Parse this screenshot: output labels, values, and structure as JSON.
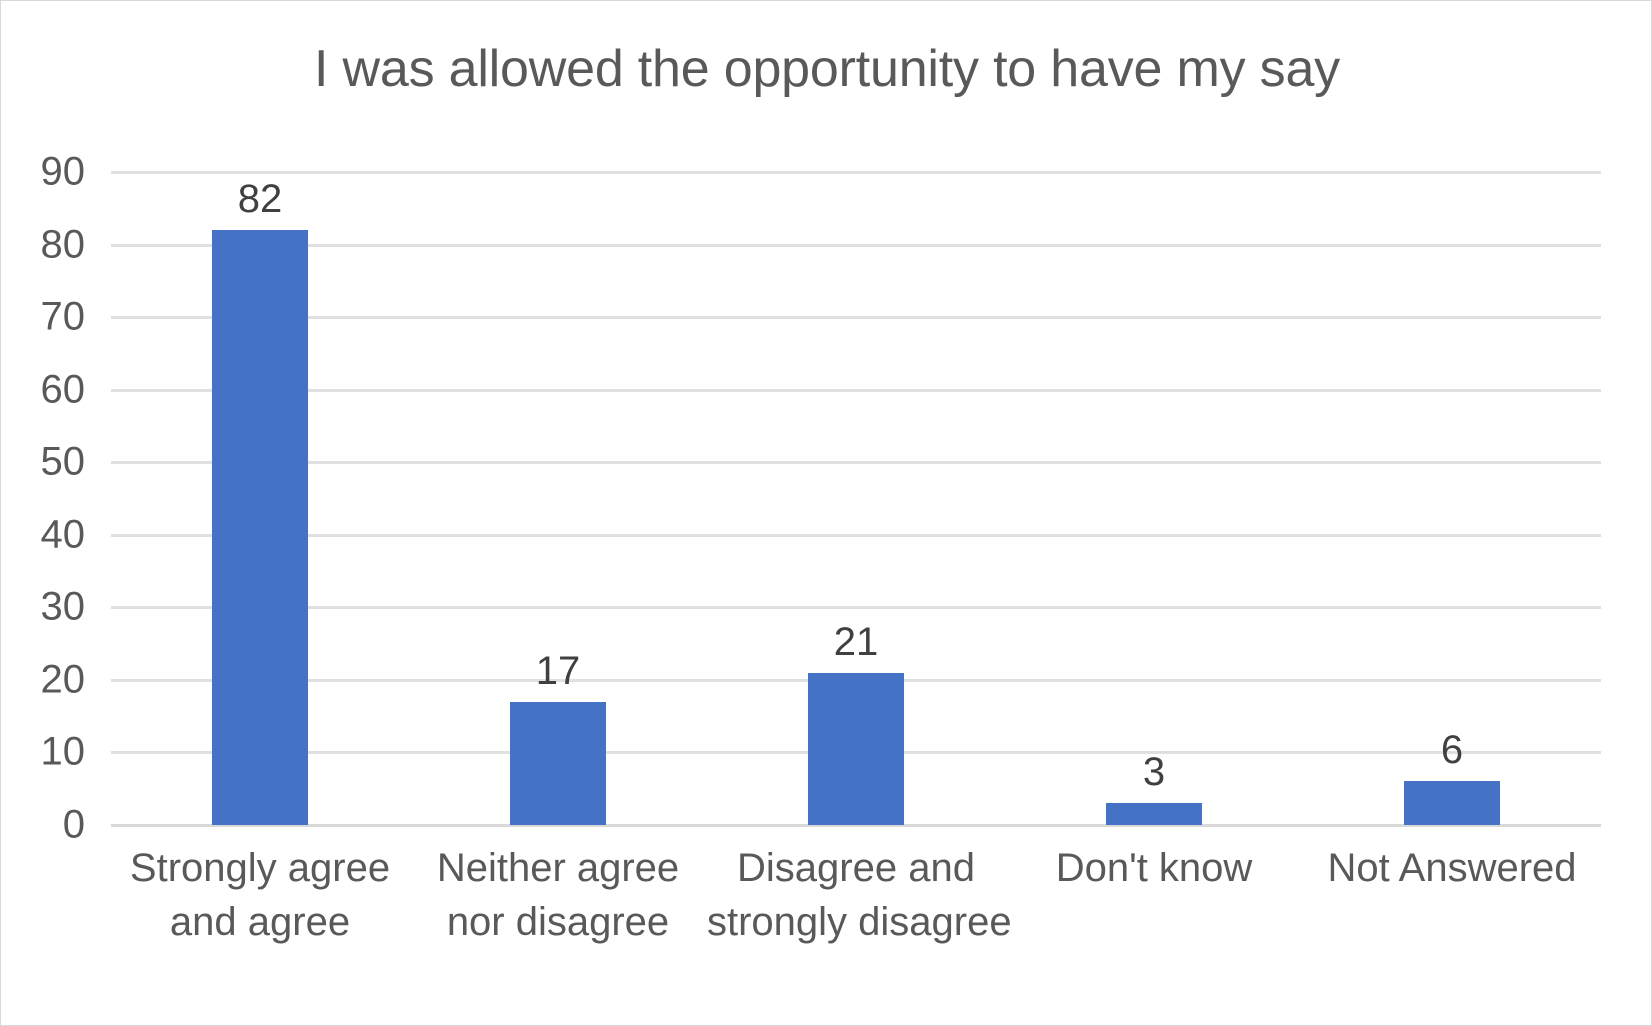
{
  "chart_data": {
    "type": "bar",
    "title": "I was allowed the opportunity to have my say",
    "categories": [
      "Strongly agree and agree",
      "Neither agree nor disagree",
      "Disagree and strongly disagree",
      "Don't know",
      "Not Answered"
    ],
    "category_lines": [
      [
        "Strongly agree",
        "and agree"
      ],
      [
        "Neither agree",
        "nor disagree"
      ],
      [
        "Disagree and",
        "strongly disagree"
      ],
      [
        "Don't know",
        ""
      ],
      [
        "Not Answered",
        ""
      ]
    ],
    "values": [
      82,
      17,
      21,
      3,
      6
    ],
    "data_labels": [
      "82",
      "17",
      "21",
      "3",
      "6"
    ],
    "xlabel": "",
    "ylabel": "",
    "ylim": [
      0,
      90
    ],
    "y_tick_step": 10,
    "y_ticks": [
      "0",
      "10",
      "20",
      "30",
      "40",
      "50",
      "60",
      "70",
      "80",
      "90"
    ],
    "grid": true,
    "legend": false,
    "legend_position": "none",
    "colors": {
      "bar": "#4472C4",
      "gridline": "#E0E0E0",
      "axis_line": "#D9D9D9",
      "title_text": "#595959",
      "tick_text": "#595959",
      "data_label_text": "#404040",
      "background": "#FFFFFF",
      "border": "#D9D9D9"
    }
  }
}
